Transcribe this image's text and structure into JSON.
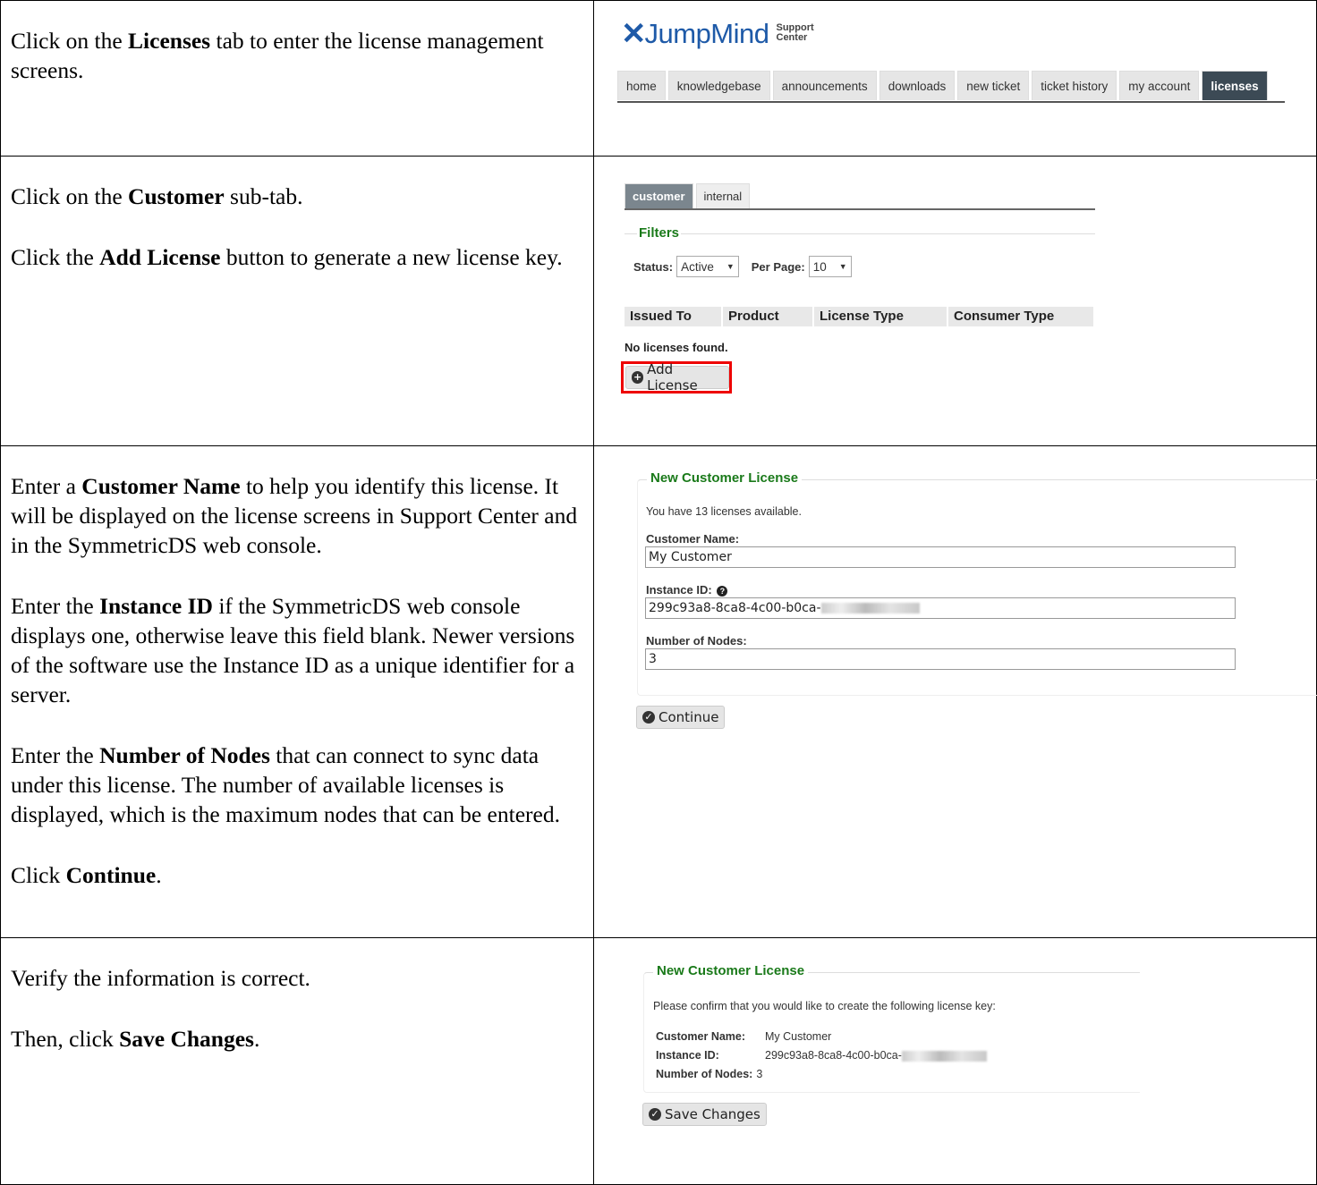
{
  "rows": [
    {
      "instructions": [
        {
          "parts": [
            {
              "t": "Click on the "
            },
            {
              "b": "Licenses"
            },
            {
              "t": " tab to enter the license management screens."
            }
          ]
        }
      ]
    },
    {
      "instructions": [
        {
          "parts": [
            {
              "t": "Click on the "
            },
            {
              "b": "Customer"
            },
            {
              "t": " sub-tab."
            }
          ]
        },
        {
          "parts": [
            {
              "t": "Click the "
            },
            {
              "b": "Add License"
            },
            {
              "t": " button to generate a new license key."
            }
          ]
        }
      ]
    },
    {
      "instructions": [
        {
          "parts": [
            {
              "t": "Enter a "
            },
            {
              "b": "Customer Name"
            },
            {
              "t": " to help you identify this license.  It will be displayed on the license screens in Support Center and in the SymmetricDS web console."
            }
          ]
        },
        {
          "parts": [
            {
              "t": "Enter the "
            },
            {
              "b": "Instance ID"
            },
            {
              "t": " if the SymmetricDS web console displays one, otherwise leave this field blank.  Newer versions of the software use the Instance ID as a unique identifier for a server."
            }
          ]
        },
        {
          "parts": [
            {
              "t": "Enter the "
            },
            {
              "b": "Number of Nodes"
            },
            {
              "t": " that can connect to sync data under this license.  The number of available licenses is displayed, which is the maximum nodes that can be entered."
            }
          ]
        },
        {
          "parts": [
            {
              "t": "Click "
            },
            {
              "b": "Continue"
            },
            {
              "t": "."
            }
          ]
        }
      ]
    },
    {
      "instructions": [
        {
          "parts": [
            {
              "t": "Verify the information is correct."
            }
          ]
        },
        {
          "parts": [
            {
              "t": "Then, click "
            },
            {
              "b": "Save Changes"
            },
            {
              "t": "."
            }
          ]
        }
      ]
    }
  ],
  "shot1": {
    "logo_text": "JumpMind",
    "logo_sub_1": "Support",
    "logo_sub_2": "Center",
    "tabs": [
      "home",
      "knowledgebase",
      "announcements",
      "downloads",
      "new ticket",
      "ticket history",
      "my account",
      "licenses"
    ],
    "active_tab": "licenses"
  },
  "shot2": {
    "subtabs": [
      "customer",
      "internal"
    ],
    "active_subtab": "customer",
    "filters_legend": "Filters",
    "status_label": "Status:",
    "status_value": "Active",
    "perpage_label": "Per Page:",
    "perpage_value": "10",
    "columns": [
      "Issued To",
      "Product",
      "License Type",
      "Consumer Type"
    ],
    "empty_text": "No licenses found.",
    "add_button": "Add License"
  },
  "shot3": {
    "legend": "New Customer License",
    "available_text": "You have 13 licenses available.",
    "customer_name_label": "Customer Name:",
    "customer_name_value": "My Customer",
    "instance_id_label": "Instance ID:",
    "instance_id_value": "299c93a8-8ca8-4c00-b0ca-",
    "nodes_label": "Number of Nodes:",
    "nodes_value": "3",
    "continue_button": "Continue"
  },
  "shot4": {
    "legend": "New Customer License",
    "confirm_text": "Please confirm that you would like to create the following license key:",
    "customer_name_label": "Customer Name:",
    "customer_name_value": "My Customer",
    "instance_id_label": "Instance ID:",
    "instance_id_value": "299c93a8-8ca8-4c00-b0ca-",
    "nodes_label": "Number of Nodes:",
    "nodes_value": "3",
    "save_button": "Save Changes"
  }
}
